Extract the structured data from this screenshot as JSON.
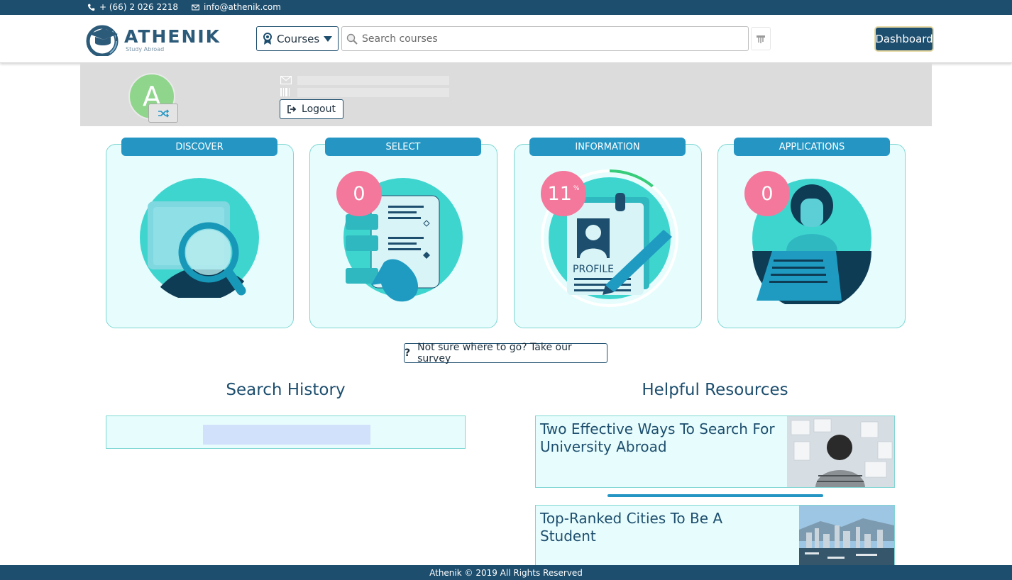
{
  "topbar": {
    "phone": "+ (66) 2 026 2218",
    "email": "info@athenik.com"
  },
  "header": {
    "logo_word": "ATHENIK",
    "logo_sub": "Study Abroad",
    "courses_label": "Courses",
    "search_placeholder": "Search courses",
    "dashboard_label": "Dashboard"
  },
  "profile": {
    "avatar_letter": "A",
    "logout_label": "Logout"
  },
  "cards": [
    {
      "label": "DISCOVER"
    },
    {
      "label": "SELECT",
      "count": "0"
    },
    {
      "label": "INFORMATION",
      "count": "11",
      "unit": "%",
      "progress": 0.11
    },
    {
      "label": "APPLICATIONS",
      "count": "0"
    }
  ],
  "survey_label": "Not sure where to go? Take our survey",
  "search_history": {
    "title": "Search History"
  },
  "resources": {
    "title": "Helpful Resources",
    "items": [
      {
        "title": "Two Effective Ways To Search For University Abroad"
      },
      {
        "title": "Top-Ranked Cities To Be A Student"
      }
    ]
  },
  "footer": {
    "text": "Athenik © 2019 All Rights Reserved"
  },
  "colors": {
    "navy": "#1d4e6e",
    "accent": "#2596c4",
    "badge": "#f3789c",
    "card_bg": "#e7fcfc"
  }
}
